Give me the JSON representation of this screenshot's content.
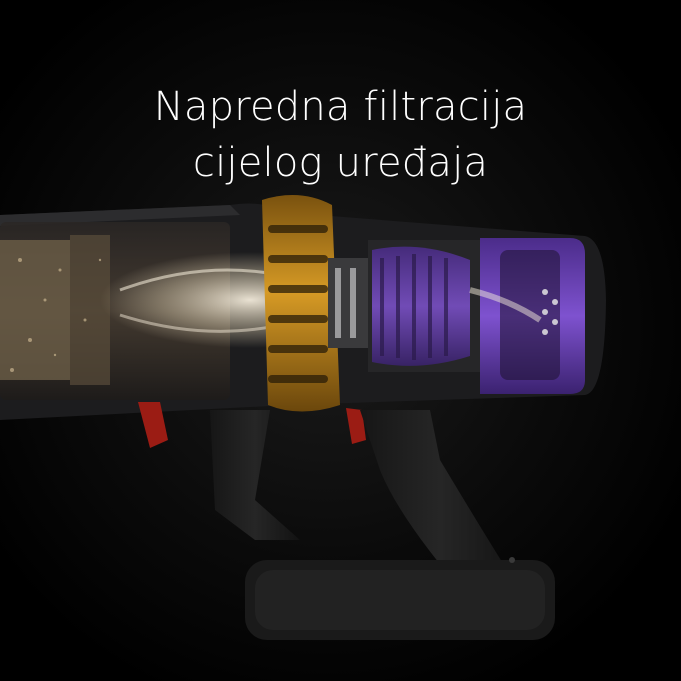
{
  "headline": {
    "line1": "Napredna filtracija",
    "line2": "cijelog uređaja"
  },
  "image": {
    "subject": "vacuum-cleaner-cutaway-icon",
    "colors": {
      "background": "#000000",
      "body": "#1c1c1e",
      "cyclone": "#c48a1c",
      "motor": "#6a3fb4",
      "trigger": "#9b1c14",
      "airflow": "#e8e0cf"
    }
  }
}
